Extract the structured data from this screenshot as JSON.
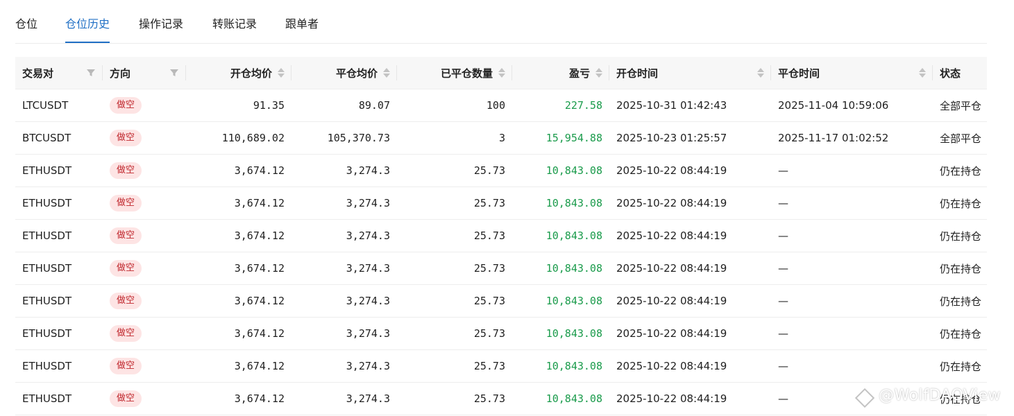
{
  "tabs": [
    {
      "label": "仓位"
    },
    {
      "label": "仓位历史"
    },
    {
      "label": "操作记录"
    },
    {
      "label": "转账记录"
    },
    {
      "label": "跟单者"
    }
  ],
  "table": {
    "columns": [
      {
        "label": "交易对"
      },
      {
        "label": "方向"
      },
      {
        "label": "开仓均价"
      },
      {
        "label": "平仓均价"
      },
      {
        "label": "已平仓数量"
      },
      {
        "label": "盈亏"
      },
      {
        "label": "开仓时间"
      },
      {
        "label": "平仓时间"
      },
      {
        "label": "状态"
      }
    ],
    "rows": [
      {
        "pair": "LTCUSDT",
        "side": "做空",
        "open_price": "91.35",
        "close_price": "89.07",
        "closed_qty": "100",
        "pnl": "227.58",
        "open_time": "2025-10-31 01:42:43",
        "close_time": "2025-11-04 10:59:06",
        "status": "全部平仓"
      },
      {
        "pair": "BTCUSDT",
        "side": "做空",
        "open_price": "110,689.02",
        "close_price": "105,370.73",
        "closed_qty": "3",
        "pnl": "15,954.88",
        "open_time": "2025-10-23 01:25:57",
        "close_time": "2025-11-17 01:02:52",
        "status": "全部平仓"
      },
      {
        "pair": "ETHUSDT",
        "side": "做空",
        "open_price": "3,674.12",
        "close_price": "3,274.3",
        "closed_qty": "25.73",
        "pnl": "10,843.08",
        "open_time": "2025-10-22 08:44:19",
        "close_time": "—",
        "status": "仍在持仓"
      },
      {
        "pair": "ETHUSDT",
        "side": "做空",
        "open_price": "3,674.12",
        "close_price": "3,274.3",
        "closed_qty": "25.73",
        "pnl": "10,843.08",
        "open_time": "2025-10-22 08:44:19",
        "close_time": "—",
        "status": "仍在持仓"
      },
      {
        "pair": "ETHUSDT",
        "side": "做空",
        "open_price": "3,674.12",
        "close_price": "3,274.3",
        "closed_qty": "25.73",
        "pnl": "10,843.08",
        "open_time": "2025-10-22 08:44:19",
        "close_time": "—",
        "status": "仍在持仓"
      },
      {
        "pair": "ETHUSDT",
        "side": "做空",
        "open_price": "3,674.12",
        "close_price": "3,274.3",
        "closed_qty": "25.73",
        "pnl": "10,843.08",
        "open_time": "2025-10-22 08:44:19",
        "close_time": "—",
        "status": "仍在持仓"
      },
      {
        "pair": "ETHUSDT",
        "side": "做空",
        "open_price": "3,674.12",
        "close_price": "3,274.3",
        "closed_qty": "25.73",
        "pnl": "10,843.08",
        "open_time": "2025-10-22 08:44:19",
        "close_time": "—",
        "status": "仍在持仓"
      },
      {
        "pair": "ETHUSDT",
        "side": "做空",
        "open_price": "3,674.12",
        "close_price": "3,274.3",
        "closed_qty": "25.73",
        "pnl": "10,843.08",
        "open_time": "2025-10-22 08:44:19",
        "close_time": "—",
        "status": "仍在持仓"
      },
      {
        "pair": "ETHUSDT",
        "side": "做空",
        "open_price": "3,674.12",
        "close_price": "3,274.3",
        "closed_qty": "25.73",
        "pnl": "10,843.08",
        "open_time": "2025-10-22 08:44:19",
        "close_time": "—",
        "status": "仍在持仓"
      },
      {
        "pair": "ETHUSDT",
        "side": "做空",
        "open_price": "3,674.12",
        "close_price": "3,274.3",
        "closed_qty": "25.73",
        "pnl": "10,843.08",
        "open_time": "2025-10-22 08:44:19",
        "close_time": "—",
        "status": "仍在持仓"
      }
    ]
  },
  "watermark": {
    "text": "@WolfDAOView"
  },
  "colors": {
    "accent": "#1f6fc5",
    "profit": "#1a9b4b",
    "badge_bg": "#fde4e4",
    "badge_text": "#c0272d",
    "header_bg": "#f7f7f7"
  }
}
